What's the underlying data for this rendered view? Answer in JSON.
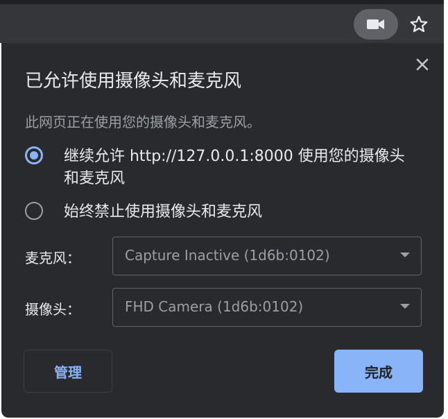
{
  "toolbar": {
    "camera_icon": "video-camera-icon",
    "star_icon": "star-outline-icon"
  },
  "dialog": {
    "close_icon": "close-icon",
    "title": "已允许使用摄像头和麦克风",
    "subtitle": "此网页正在使用您的摄像头和麦克风。",
    "options": [
      {
        "label": "继续允许 http://127.0.0.1:8000 使用您的摄像头和麦克风",
        "selected": true
      },
      {
        "label": "始终禁止使用摄像头和麦克风",
        "selected": false
      }
    ],
    "microphone": {
      "label": "麦克风：",
      "value": "Capture Inactive (1d6b:0102)"
    },
    "camera": {
      "label": "摄像头：",
      "value": "FHD Camera (1d6b:0102)"
    },
    "manage_label": "管理",
    "done_label": "完成"
  },
  "colors": {
    "dialog_bg": "#292a2d",
    "accent": "#8ab4f8",
    "text_primary": "#e8eaed",
    "text_secondary": "#9aa0a6"
  }
}
